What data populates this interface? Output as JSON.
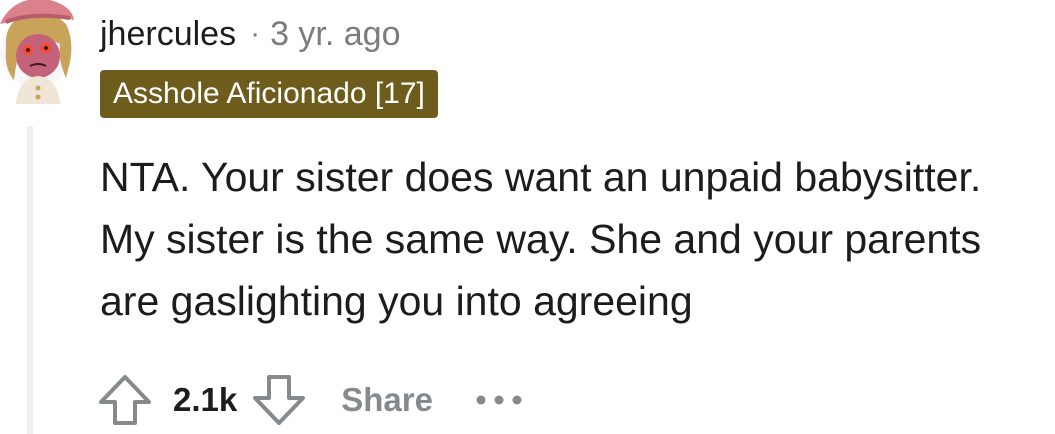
{
  "comment": {
    "author": "jhercules",
    "separator": "·",
    "timestamp": "3 yr. ago",
    "flair": {
      "text": "Asshole Aficionado [17]",
      "background_color": "#6d5c1b",
      "text_color": "#ffffff"
    },
    "body": {
      "lines": [
        "NTA. Your sister does want an unpaid babysitter.",
        "My sister is the same way. She and your parents",
        "are gaslighting you into agreeing"
      ]
    },
    "actions": {
      "upvote_icon": "upvote-arrow-icon",
      "score": "2.1k",
      "downvote_icon": "downvote-arrow-icon",
      "share_label": "Share",
      "more_icon": "ellipsis-icon"
    }
  },
  "colors": {
    "text_primary": "#1c1c1c",
    "text_meta": "#7c7c7c",
    "action_gray": "#878a8c",
    "thread_line": "#edeff1"
  }
}
